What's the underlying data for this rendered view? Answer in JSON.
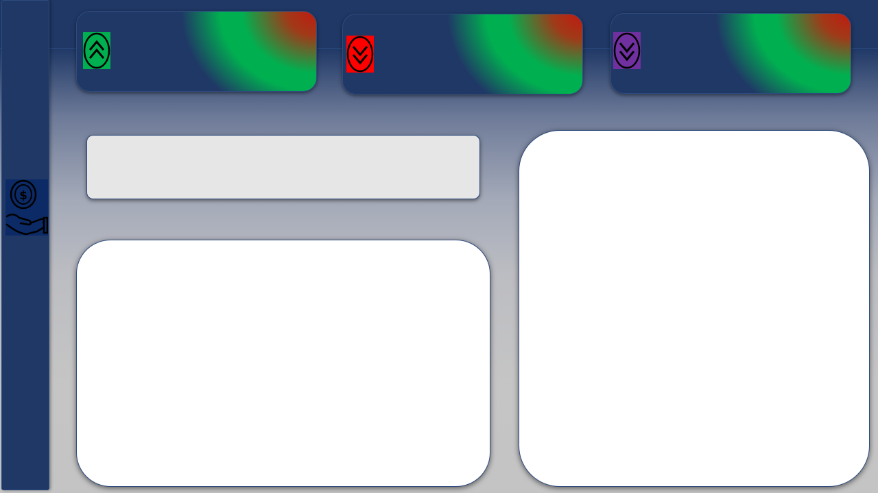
{
  "colors": {
    "navy": "#1f3866",
    "kpi_up": "#00b050",
    "kpi_down": "#ff0000",
    "kpi_neutral": "#7030a0",
    "panel_light": "#e6e6e6",
    "panel_white": "#ffffff"
  },
  "sidebar": {
    "icon": "hand-holding-coin-icon"
  },
  "kpis": [
    {
      "icon": "double-chevron-up-icon",
      "color": "#00b050"
    },
    {
      "icon": "double-chevron-down-icon",
      "color": "#ff0000"
    },
    {
      "icon": "double-chevron-down-icon",
      "color": "#7030a0"
    }
  ]
}
